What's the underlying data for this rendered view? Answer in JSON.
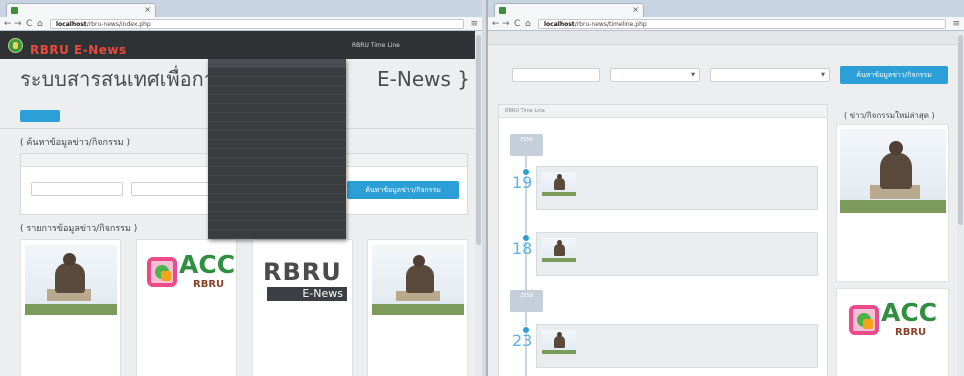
{
  "left_window": {
    "tab_title": "",
    "tab_close": "×",
    "address_host": "localhost",
    "address_path": "/rbru-news/index.php",
    "nav_back": "←",
    "nav_forward": "→",
    "nav_reload": "C",
    "nav_home": "⌂",
    "menu_icon": "≡",
    "site": {
      "brand_small": "",
      "brand_big": "RBRU E-News",
      "nav": [
        "",
        "",
        "",
        "RBRU Time Line",
        "",
        ""
      ],
      "hero_title_left": "ระบบสารสนเทศเพื่อการสื่อส",
      "hero_title_right": "E-News }",
      "hero_subtitle": "",
      "breadcrumb": "",
      "search_section_title": "( ค้นหาข้อมูลข่าว/กิจกรรม )",
      "search_panel_head": "",
      "search_labels": [
        "",
        ""
      ],
      "search_inputs": [
        "",
        ""
      ],
      "search_button": "ค้นหาข้อมูลข่าว/กิจกรรม",
      "list_section_title": "( รายการข้อมูลข่าว/กิจกรรม )",
      "dropdown_items": [
        "",
        "",
        "",
        "",
        "",
        "",
        "",
        "",
        "",
        "",
        "",
        "",
        "",
        "",
        "",
        "",
        "",
        "",
        "",
        ""
      ],
      "cards": [
        {
          "title": "",
          "text": ""
        },
        {
          "title": "",
          "text": ""
        },
        {
          "title": "",
          "text": ""
        },
        {
          "title": "",
          "text": ""
        }
      ],
      "acc_logo_text": "ACC",
      "acc_logo_sub": "RBRU",
      "enews_logo_big": "RBRU",
      "enews_logo_small": "E-News"
    }
  },
  "right_window": {
    "tab_title": "",
    "tab_close": "×",
    "address_host": "localhost",
    "address_path": "/rbru-news/timeline.php",
    "nav_back": "←",
    "nav_forward": "→",
    "nav_reload": "C",
    "nav_home": "⌂",
    "menu_icon": "≡",
    "search_head": "",
    "search_labels": [
      "",
      "",
      ""
    ],
    "search_inputs": [
      "",
      "",
      ""
    ],
    "search_button": "ค้นหาข้อมูลข่าว/กิจกรรม",
    "timeline_head": "RBRU Time Line",
    "side_title": "( ข่าว/กิจกรรมใหม่ล่าสุด )",
    "timeline": [
      {
        "month_badge": "",
        "month_badge_year": "2558",
        "day": "19",
        "dow": "",
        "title": "",
        "text": "",
        "meta": ""
      },
      {
        "month_badge": "",
        "month_badge_year": "",
        "day": "18",
        "dow": "",
        "title": "",
        "text": "",
        "meta": ""
      },
      {
        "month_badge": "",
        "month_badge_year": "2558",
        "day": "23",
        "dow": "",
        "title": "",
        "text": "",
        "meta": ""
      }
    ],
    "side_card": {
      "title": "",
      "text": ""
    },
    "side_acc_text": "ACC",
    "side_acc_sub": "RBRU",
    "side_acc_title": ""
  }
}
